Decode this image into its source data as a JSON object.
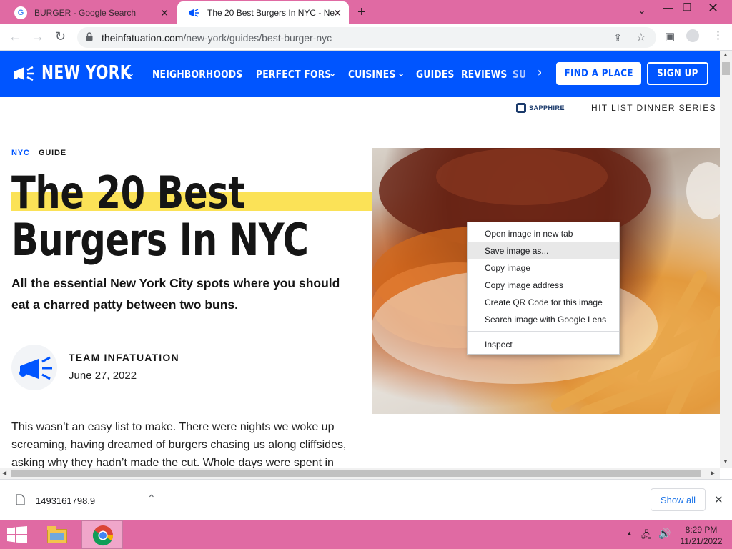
{
  "browser": {
    "tabs": [
      {
        "title": "BURGER - Google Search",
        "icon": "google-icon",
        "active": false
      },
      {
        "title": "The 20 Best Burgers In NYC - Ne",
        "icon": "infatuation-megaphone-icon",
        "active": true
      }
    ],
    "url_domain": "theinfatuation.com",
    "url_path": "/new-york/guides/best-burger-nyc"
  },
  "site": {
    "city": "NEW YORK",
    "nav": [
      "NEIGHBORHOODS",
      "PERFECT FORS",
      "CUISINES",
      "GUIDES",
      "REVIEWS",
      "SU"
    ],
    "find_place": "FIND A PLACE",
    "sign_up": "SIGN UP",
    "sponsor": "SAPPHIRE",
    "hit_list": "HIT LIST DINNER SERIES",
    "brand_color": "#0055ff"
  },
  "article": {
    "tag_city": "NYC",
    "tag_type": "GUIDE",
    "title_line1": "The 20 Best",
    "title_line2": "Burgers In NYC",
    "subtitle": "All the essential New York City spots where you should eat a charred patty between two buns.",
    "author": "TEAM INFATUATION",
    "date": "June 27, 2022",
    "body": "This wasn’t an easy list to make. There were nights we woke up screaming, having dreamed of burgers chasing us along cliffsides, asking why they hadn’t made the cut. Whole days were spent in"
  },
  "context_menu": {
    "items": [
      "Open image in new tab",
      "Save image as...",
      "Copy image",
      "Copy image address",
      "Create QR Code for this image",
      "Search image with Google Lens"
    ],
    "inspect": "Inspect",
    "highlighted_index": 1
  },
  "download_bar": {
    "file_name": "1493161798.9",
    "show_all": "Show all"
  },
  "taskbar": {
    "time": "8:29 PM",
    "date": "11/21/2022"
  }
}
